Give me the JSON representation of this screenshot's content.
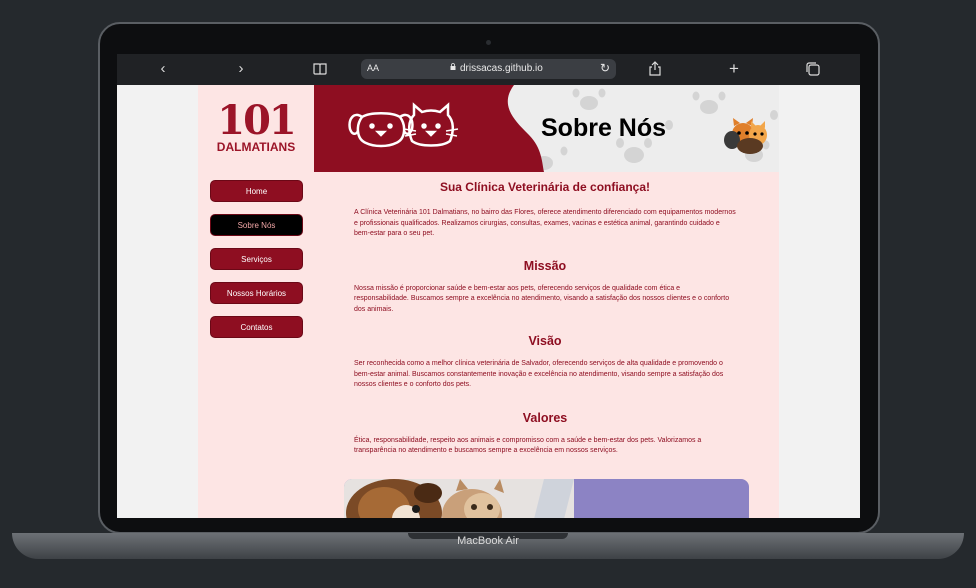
{
  "device": {
    "label": "MacBook Air"
  },
  "browser": {
    "text_size_label": "AA",
    "url": "drissacas.github.io",
    "icons": [
      "back-icon",
      "forward-icon",
      "reader-icon",
      "lock-icon",
      "reload-icon",
      "share-icon",
      "new-tab-icon",
      "tabs-icon"
    ]
  },
  "logo": {
    "number": "101",
    "word": "DALMATIANS"
  },
  "banner": {
    "title": "Sobre Nós"
  },
  "nav": {
    "items": [
      {
        "label": "Home",
        "active": false
      },
      {
        "label": "Sobre Nós",
        "active": true
      },
      {
        "label": "Serviços",
        "active": false
      },
      {
        "label": "Nossos Horários",
        "active": false
      },
      {
        "label": "Contatos",
        "active": false
      }
    ]
  },
  "sections": {
    "intro": {
      "title": "Sua Clínica Veterinária de confiança!",
      "text": "A Clínica Veterinária 101 Dalmatians, no bairro das Flores, oferece atendimento diferenciado com equipamentos modernos e profissionais qualificados. Realizamos cirurgias, consultas, exames, vacinas e estética animal, garantindo cuidado e bem-estar para o seu pet."
    },
    "missao": {
      "title": "Missão",
      "text": "Nossa missão é proporcionar saúde e bem-estar aos pets, oferecendo serviços de qualidade com ética e responsabilidade. Buscamos sempre a excelência no atendimento, visando a satisfação dos nossos clientes e o conforto dos animais."
    },
    "visao": {
      "title": "Visão",
      "text": "Ser reconhecida como a melhor clínica veterinária de Salvador, oferecendo serviços de alta qualidade e promovendo o bem-estar animal. Buscamos constantemente inovação e excelência no atendimento, visando sempre a satisfação dos nossos clientes e o conforto dos pets."
    },
    "valores": {
      "title": "Valores",
      "text": "Ética, responsabilidade, respeito aos animais e compromisso com a saúde e bem-estar dos pets. Valorizamos a transparência no atendimento e buscamos sempre a excelência em nossos serviços."
    }
  },
  "colors": {
    "brand": "#8e0e21",
    "page_background": "#fde5e4",
    "browser_chrome": "#202225"
  }
}
